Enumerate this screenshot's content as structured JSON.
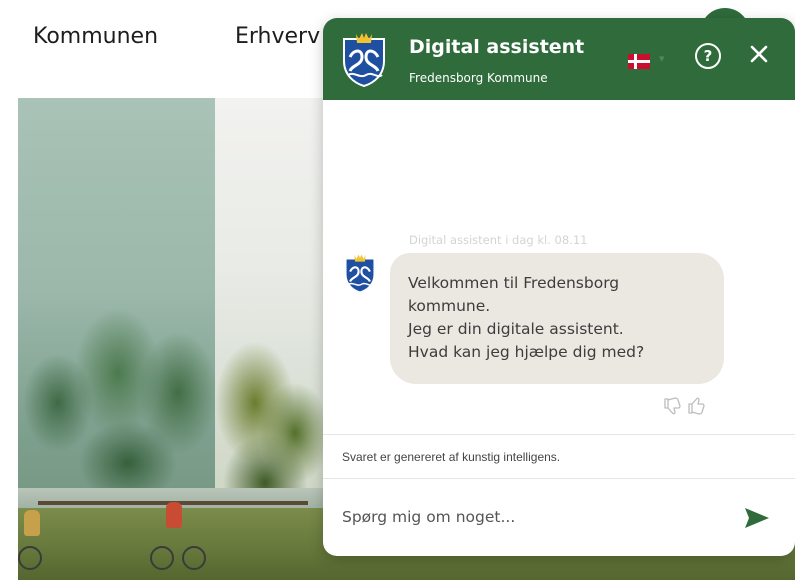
{
  "site": {
    "nav": [
      "Kommunen",
      "Erhverv"
    ]
  },
  "chat": {
    "title": "Digital assistent",
    "subtitle": "Fredensborg Kommune",
    "help_label": "?",
    "language_flag": "danish-flag",
    "message": {
      "meta": "Digital assistent i dag kl. 08.11",
      "lines": [
        "Velkommen til Fredensborg",
        "kommune.",
        "Jeg er din digitale assistent.",
        "Hvad kan jeg hjælpe dig med?"
      ]
    },
    "disclaimer": "Svaret er genereret af kunstig intelligens.",
    "input_placeholder": "Spørg mig om noget..."
  },
  "colors": {
    "header": "#2f6b3b",
    "bubble": "#ebe7e1",
    "send_icon": "#2f6b3b"
  },
  "icons": [
    "municipality-logo-icon",
    "danish-flag-icon",
    "chevron-down-icon",
    "help-icon",
    "close-icon",
    "thumbs-down-icon",
    "thumbs-up-icon",
    "send-icon"
  ]
}
